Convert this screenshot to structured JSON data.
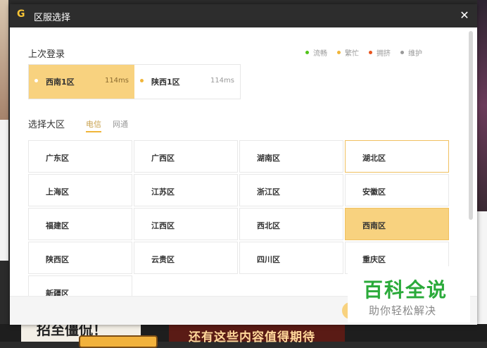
{
  "window": {
    "title": "区服选择"
  },
  "legend": [
    {
      "label": "流畅",
      "color": "#52c41a"
    },
    {
      "label": "繁忙",
      "color": "#f0b53a"
    },
    {
      "label": "拥挤",
      "color": "#e8541e"
    },
    {
      "label": "维护",
      "color": "#999999"
    }
  ],
  "last_login": {
    "label": "上次登录",
    "servers": [
      {
        "name": "西南1区",
        "ping": "114ms",
        "selected": true
      },
      {
        "name": "陕西1区",
        "ping": "114ms",
        "selected": false
      }
    ]
  },
  "select": {
    "label": "选择大区",
    "tabs": [
      {
        "label": "电信",
        "active": true
      },
      {
        "label": "网通",
        "active": false
      }
    ]
  },
  "regions": [
    "广东区",
    "广西区",
    "湖南区",
    "湖北区",
    "上海区",
    "江苏区",
    "浙江区",
    "安徽区",
    "福建区",
    "江西区",
    "西北区",
    "西南区",
    "陕西区",
    "云贵区",
    "四川区",
    "重庆区",
    "新疆区"
  ],
  "selected_region": "西南区",
  "hover_region": "湖北区",
  "watermark": {
    "title": "百科全说",
    "subtitle": "助你轻松解决"
  },
  "background": {
    "left_text": "招至僵侃！",
    "mid_text": "还有这些内容值得期待"
  },
  "accent_color": "#f8d27f"
}
